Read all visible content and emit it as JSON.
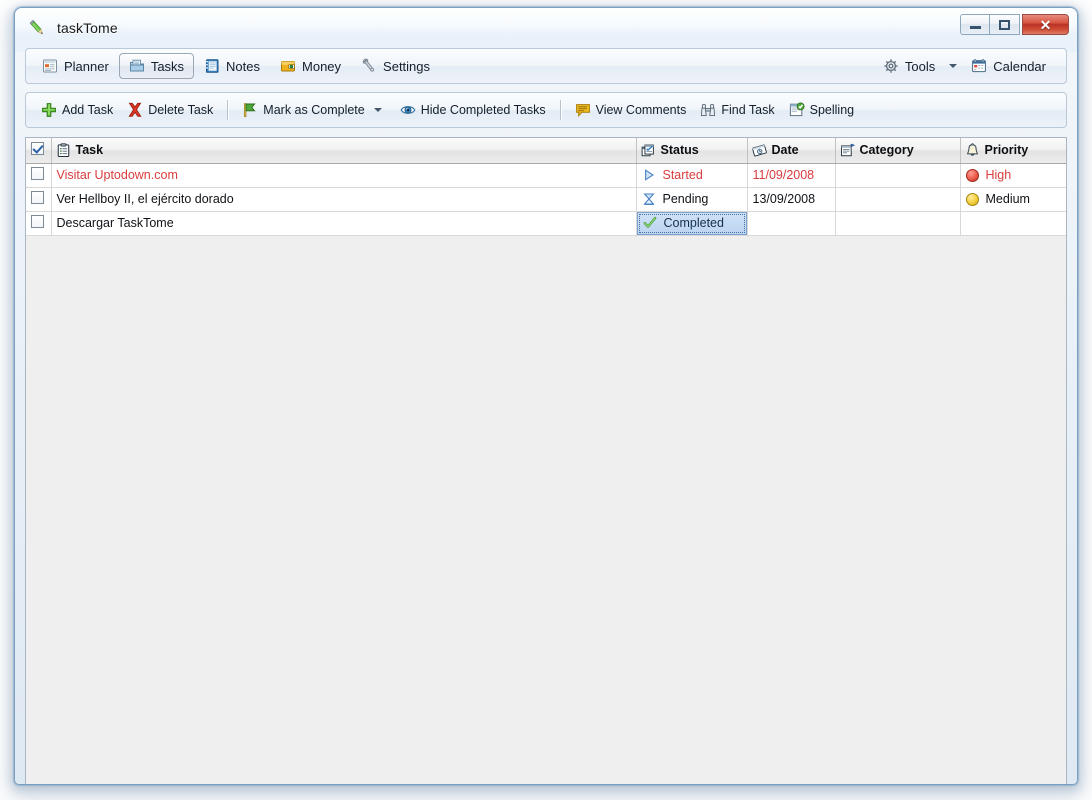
{
  "window": {
    "title": "taskTome",
    "app_icon": "pencil-icon",
    "controls": {
      "minimize": "minimize-button",
      "maximize": "maximize-button",
      "close": "close-button",
      "close_glyph": "✕"
    }
  },
  "nav": {
    "items": [
      {
        "label": "Planner",
        "icon": "planner-icon",
        "active": false
      },
      {
        "label": "Tasks",
        "icon": "tasks-icon",
        "active": true
      },
      {
        "label": "Notes",
        "icon": "notes-icon",
        "active": false
      },
      {
        "label": "Money",
        "icon": "money-icon",
        "active": false
      },
      {
        "label": "Settings",
        "icon": "settings-icon",
        "active": false
      }
    ],
    "right_items": [
      {
        "label": "Tools",
        "icon": "gear-icon",
        "has_caret": true
      },
      {
        "label": "Calendar",
        "icon": "calendar-icon",
        "has_caret": false
      }
    ]
  },
  "toolbar": {
    "items": [
      {
        "label": "Add Task",
        "icon": "plus-icon",
        "caret": false
      },
      {
        "label": "Delete Task",
        "icon": "red-x-icon",
        "caret": false
      },
      {
        "sep": true
      },
      {
        "label": "Mark as Complete",
        "icon": "flag-icon",
        "caret": true
      },
      {
        "label": "Hide Completed Tasks",
        "icon": "eye-icon",
        "caret": false
      },
      {
        "sep": true
      },
      {
        "label": "View Comments",
        "icon": "comment-icon",
        "caret": false
      },
      {
        "label": "Find Task",
        "icon": "binoculars-icon",
        "caret": false
      },
      {
        "label": "Spelling",
        "icon": "spelling-icon",
        "caret": false
      }
    ]
  },
  "table": {
    "columns": [
      {
        "key": "check",
        "label": "",
        "icon": "checkbox-header-icon"
      },
      {
        "key": "task",
        "label": "Task",
        "icon": "task-list-icon"
      },
      {
        "key": "status",
        "label": "Status",
        "icon": "status-icon"
      },
      {
        "key": "date",
        "label": "Date",
        "icon": "date-icon"
      },
      {
        "key": "category",
        "label": "Category",
        "icon": "category-icon"
      },
      {
        "key": "priority",
        "label": "Priority",
        "icon": "bell-icon"
      }
    ],
    "header_checkbox_checked": true,
    "rows": [
      {
        "checked": false,
        "task": "Visitar Uptodown.com",
        "status": "Started",
        "status_icon": "play-triangle-icon",
        "date": "11/09/2008",
        "category": "",
        "priority": "High",
        "priority_icon": "red-dot-icon",
        "text_color": "#d93c3c",
        "selected_cell": ""
      },
      {
        "checked": false,
        "task": "Ver Hellboy II, el ejército dorado",
        "status": "Pending",
        "status_icon": "hourglass-icon",
        "date": "13/09/2008",
        "category": "",
        "priority": "Medium",
        "priority_icon": "yellow-dot-icon",
        "text_color": "#101418",
        "selected_cell": ""
      },
      {
        "checked": false,
        "task": "Descargar TaskTome",
        "status": "Completed",
        "status_icon": "green-check-icon",
        "date": "",
        "category": "",
        "priority": "",
        "priority_icon": "",
        "text_color": "#101418",
        "selected_cell": "status"
      }
    ]
  },
  "colors": {
    "accent_red": "#d93c3c",
    "selection_blue": "#bcd5f1",
    "panel_bg": "#efefef",
    "frame_blue": "#7a9fc0"
  }
}
